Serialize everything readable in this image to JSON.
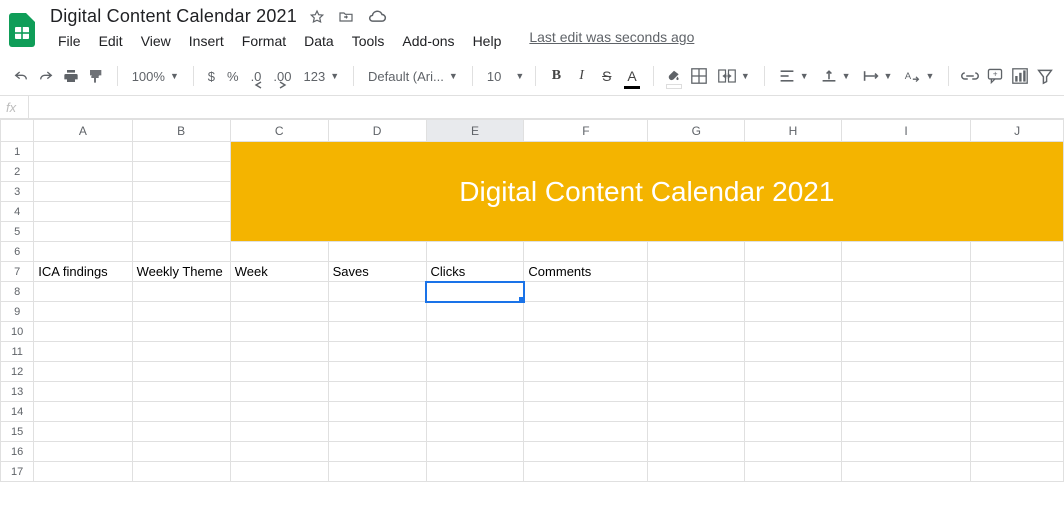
{
  "header": {
    "title": "Digital Content Calendar 2021",
    "last_edit": "Last edit was seconds ago",
    "menus": [
      "File",
      "Edit",
      "View",
      "Insert",
      "Format",
      "Data",
      "Tools",
      "Add-ons",
      "Help"
    ]
  },
  "toolbar": {
    "zoom": "100%",
    "font": "Default (Ari...",
    "font_size": "10",
    "currency": "$",
    "percent": "%",
    "dec_less": ".0",
    "dec_more": ".00",
    "num_format": "123"
  },
  "formula_bar": {
    "fx": "fx"
  },
  "grid": {
    "columns": [
      "A",
      "B",
      "C",
      "D",
      "E",
      "F",
      "G",
      "H",
      "I",
      "J"
    ],
    "rows": [
      "1",
      "2",
      "3",
      "4",
      "5",
      "6",
      "7",
      "8",
      "9",
      "10",
      "11",
      "12",
      "13",
      "14",
      "15",
      "16",
      "17"
    ],
    "banner": "Digital Content Calendar 2021",
    "row7": {
      "A": "ICA findings",
      "B": "Weekly Theme",
      "C": "Week",
      "D": "Saves",
      "E": "Clicks",
      "F": "Comments",
      "G": "",
      "H": "",
      "I": "",
      "J": ""
    }
  }
}
